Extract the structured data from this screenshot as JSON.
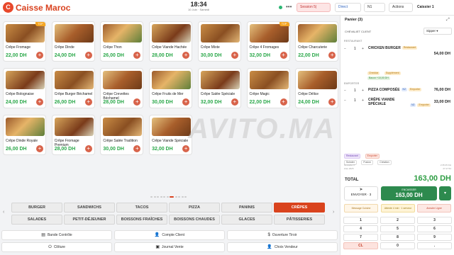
{
  "header": {
    "logo_letter": "C",
    "title": "Caisse Maroc",
    "time": "18:34",
    "date": "10 Juin · Samedi",
    "menu_glyph": "•••",
    "session_label": "Session 5|",
    "direct_label": "Direct",
    "n1_label": "N1",
    "actions_label": "Actions",
    "caissier_label": "Caissier 1"
  },
  "products": [
    {
      "name": "Crêpe Fromage",
      "price": "22,00 DH",
      "badge": "TOP"
    },
    {
      "name": "Crêpe Dinde",
      "price": "24,00 DH"
    },
    {
      "name": "Crêpe Thon",
      "price": "26,00 DH"
    },
    {
      "name": "Crêpe Viande Hachée",
      "price": "28,00 DH"
    },
    {
      "name": "Crêpe Mixte",
      "price": "30,00 DH"
    },
    {
      "name": "Crêpe 4 Fromages",
      "price": "32,00 DH",
      "badge": "TOP"
    },
    {
      "name": "Crêpe Charcuterie",
      "price": "22,00 DH"
    },
    {
      "name": "Crêpe Bolognaise",
      "price": "24,00 DH"
    },
    {
      "name": "Crêpe Burger Béchamel",
      "price": "26,00 DH"
    },
    {
      "name": "Crêpe Crevettes Béchamel",
      "price": "28,00 DH"
    },
    {
      "name": "Crêpe Fruits de Mer",
      "price": "30,00 DH"
    },
    {
      "name": "Crêpe Salée Spéciale",
      "price": "32,00 DH"
    },
    {
      "name": "Crêpe Magic",
      "price": "22,00 DH"
    },
    {
      "name": "Crêpe Délice",
      "price": "24,00 DH"
    },
    {
      "name": "Crêpe Dinde Royale",
      "price": "26,00 DH"
    },
    {
      "name": "Crêpe Fromage Premium",
      "price": "28,00 DH"
    },
    {
      "name": "Crêpe Salée Tradition",
      "price": "30,00 DH"
    },
    {
      "name": "Crêpe Viande Spéciale",
      "price": "32,00 DH"
    }
  ],
  "watermark": "AVITO.MA",
  "categories": [
    "BURGER",
    "SANDWICHS",
    "TACOS",
    "PIZZA",
    "PANINIS",
    "CRÊPES",
    "SALADES",
    "PETIT-DÉJEUNER",
    "BOISSONS FRAÎCHES",
    "BOISSONS CHAUDES",
    "GLACES",
    "PÂTISSERIES"
  ],
  "actions": [
    "Bande Contrôle",
    "Compte Client",
    "Ouverture Tiroir",
    "Clôture",
    "Journal Vente",
    "Choix Vendeur"
  ],
  "cart": {
    "title": "Panier (3)",
    "client_label": "CHEVALIET CLIENT",
    "sipper_label": "Sipper",
    "section_restaurant": "RESTAURANT",
    "section_emporter": "EMPORTER",
    "lines": [
      {
        "qty": "1",
        "name": "CHICKEN BURGER",
        "tag": "Restaurant",
        "price": "54,00 DH"
      },
      {
        "qty": "1",
        "name": "PIZZA COMPOSÉE",
        "tag": "Emporter",
        "tag2": "N2",
        "price": "76,00 DH"
      },
      {
        "qty": "1",
        "name": "CRÊPE VIANDE SPÉCIALE",
        "tag": "Emporter",
        "tag2": "N2",
        "price": "33,00 DH"
      }
    ],
    "options": [
      "Cheddar",
      "Supplément",
      "Bacon +10,00 DH"
    ],
    "modes": [
      "Restaurant",
      "Emporter"
    ],
    "controls": [
      "Scinder",
      "Fusion",
      "Création"
    ],
    "meta_left": [
      "Nouvelle N°",
      "Zoïe 2025"
    ],
    "meta_right": [
      "2:35:25 DH",
      "27:17:54"
    ]
  },
  "total": {
    "label": "TOTAL",
    "value": "163,00 DH"
  },
  "payment": {
    "send_label": "ENVOYER · 3",
    "cash_label": "ENCAISSER",
    "cash_value": "163,00 DH",
    "more_glyph": "▾",
    "message_label": "Message Cuisine",
    "attente_label": "Attente 4 min · 1 serveur",
    "annuler_label": "Annuler Ligne"
  },
  "keypad": [
    "1",
    "2",
    "3",
    "4",
    "5",
    "6",
    "7",
    "8",
    "9",
    "CL",
    "0",
    "."
  ],
  "colors": {
    "brand": "#d9421f",
    "price": "#2ba84a",
    "cash": "#2d8a4e"
  }
}
